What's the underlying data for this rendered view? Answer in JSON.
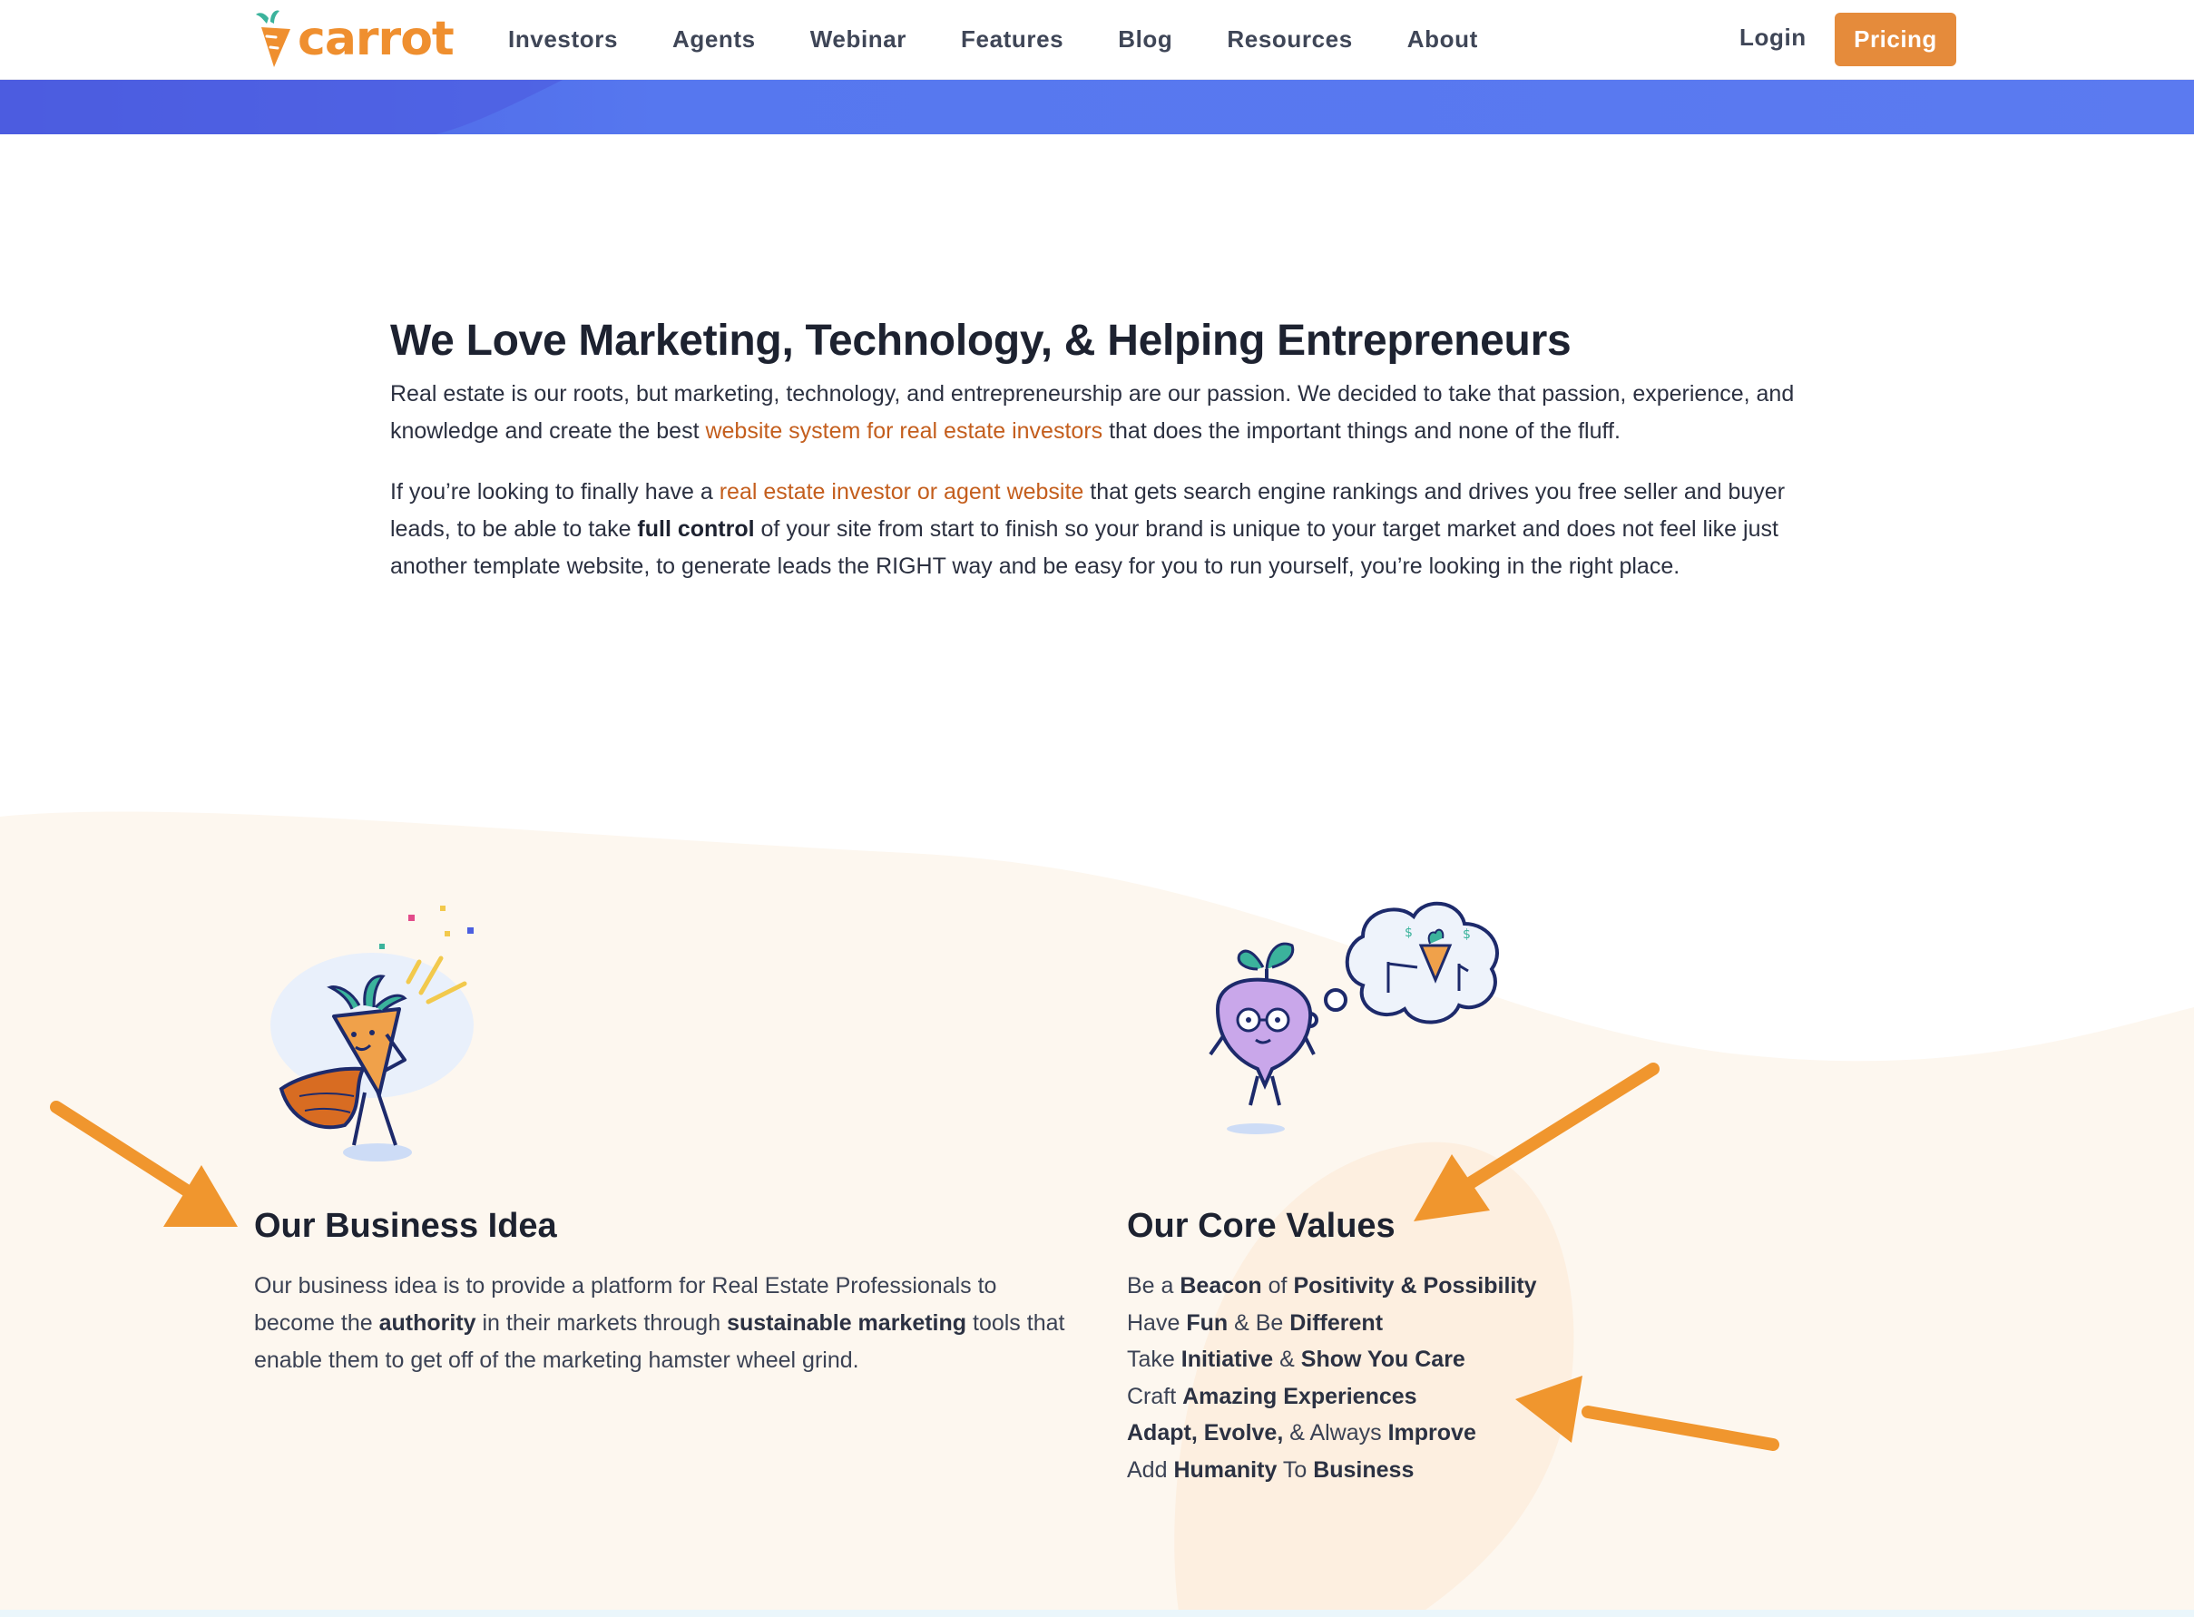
{
  "header": {
    "logo_text": "carrot",
    "nav": [
      "Investors",
      "Agents",
      "Webinar",
      "Features",
      "Blog",
      "Resources",
      "About"
    ],
    "login_label": "Login",
    "pricing_label": "Pricing"
  },
  "intro": {
    "heading": "We Love Marketing, Technology, & Helping Entrepreneurs",
    "p1_a": "Real estate is our roots, but marketing, technology, and entrepreneurship are our passion. We decided to take that passion, experience, and knowledge and create the best ",
    "p1_link": "website system for real estate investors",
    "p1_b": " that does the important things and none of the fluff.",
    "p2_a": "If you’re looking to finally have a ",
    "p2_link": "real estate investor or agent website",
    "p2_b": " that gets search engine rankings and drives you free seller and buyer leads, to be able to take ",
    "p2_strong": "full control",
    "p2_c": " of your site from start to finish so your brand is unique to your target market and does not feel like just another template website, to generate leads the RIGHT way and be easy for you to run yourself, you’re looking in the right place."
  },
  "business": {
    "title": "Our Business Idea",
    "t1": "Our business idea is to provide a platform for Real Estate Professionals to become the ",
    "b1": "authority",
    "t2": " in their markets through ",
    "b2": "sustainable marketing",
    "t3": " tools that enable them to get off of the marketing hamster wheel grind."
  },
  "values": {
    "title": "Our Core Values",
    "v1": {
      "a": "Be a ",
      "b": "Beacon",
      "c": " of ",
      "d": "Positivity & Possibility"
    },
    "v2": {
      "a": "Have ",
      "b": "Fun",
      "c": " & Be ",
      "d": "Different"
    },
    "v3": {
      "a": "Take ",
      "b": "Initiative",
      "c": " & ",
      "d": "Show You Care"
    },
    "v4": {
      "a": "Craft ",
      "b": "Amazing Experiences"
    },
    "v5": {
      "b": "Adapt, Evolve,",
      "c": " & Always ",
      "d": "Improve"
    },
    "v6": {
      "a": "Add ",
      "b": "Humanity",
      "c": " To ",
      "d": "Business"
    }
  },
  "colors": {
    "brand_orange": "#ef8f2f",
    "pricing_button": "#e58b3b",
    "banner_blue": "#5a7af0",
    "link_orange": "#c45e1d",
    "section_cream": "#fdf7ef",
    "arrow_orange": "#f0962e"
  },
  "icons": [
    "carrot-logo-icon",
    "superhero-carrot-illustration",
    "thinking-turnip-illustration",
    "annotation-arrow-icon"
  ]
}
